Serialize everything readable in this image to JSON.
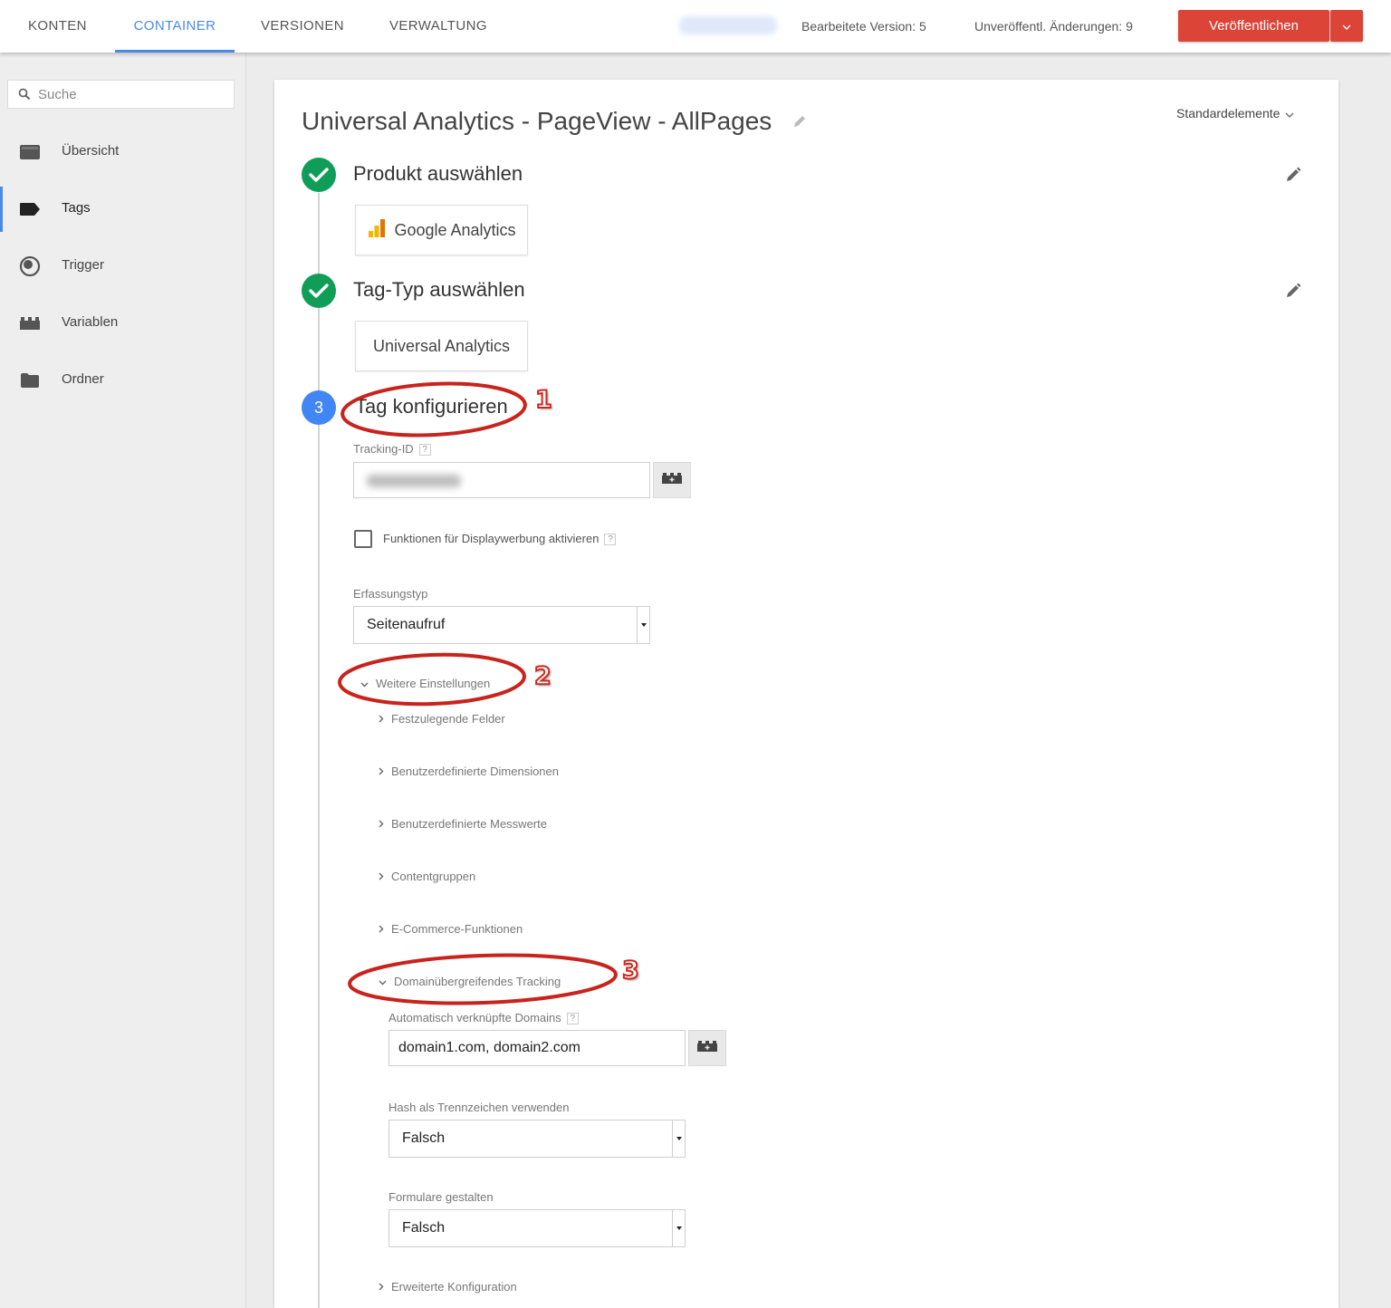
{
  "topbar": {
    "nav": [
      "KONTEN",
      "CONTAINER",
      "VERSIONEN",
      "VERWALTUNG"
    ],
    "edited_version": "Bearbeitete Version:  5",
    "unpublished_changes": "Unveröffentl. Änderungen: 9",
    "publish_label": "Veröffentlichen",
    "accent_color": "#4a8ae6",
    "publish_color": "#db4437"
  },
  "sidebar": {
    "search_placeholder": "Suche",
    "items": [
      {
        "label": "Übersicht",
        "icon": "overview-icon"
      },
      {
        "label": "Tags",
        "icon": "tag-icon"
      },
      {
        "label": "Trigger",
        "icon": "trigger-icon"
      },
      {
        "label": "Variablen",
        "icon": "variables-icon"
      },
      {
        "label": "Ordner",
        "icon": "folder-icon"
      }
    ],
    "active_item": "Tags"
  },
  "main": {
    "title": "Universal Analytics - PageView - AllPages",
    "standard_elements": "Standardelemente",
    "steps": [
      {
        "title": "Produkt auswählen",
        "selection": "Google Analytics"
      },
      {
        "title": "Tag-Typ auswählen",
        "selection": "Universal Analytics"
      },
      {
        "number": "3",
        "title": "Tag konfigurieren"
      }
    ],
    "tracking_id_label": "Tracking-ID",
    "display_ads_label": "Funktionen für Displaywerbung aktivieren",
    "capture_type_label": "Erfassungstyp",
    "capture_type_value": "Seitenaufruf",
    "more_settings": "Weitere Einstellungen",
    "subsections": [
      "Festzulegende Felder",
      "Benutzerdefinierte Dimensionen",
      "Benutzerdefinierte Messwerte",
      "Contentgruppen",
      "E-Commerce-Funktionen"
    ],
    "cross_domain": "Domainübergreifendes Tracking",
    "auto_link_label": "Automatisch verknüpfte Domains",
    "auto_link_value": "domain1.com, domain2.com",
    "hash_label": "Hash als Trennzeichen verwenden",
    "hash_value": "Falsch",
    "decorate_forms_label": "Formulare gestalten",
    "decorate_forms_value": "Falsch",
    "advanced_config": "Erweiterte Konfiguration",
    "help_mark": "?"
  },
  "annotations": [
    "1",
    "2",
    "3"
  ]
}
